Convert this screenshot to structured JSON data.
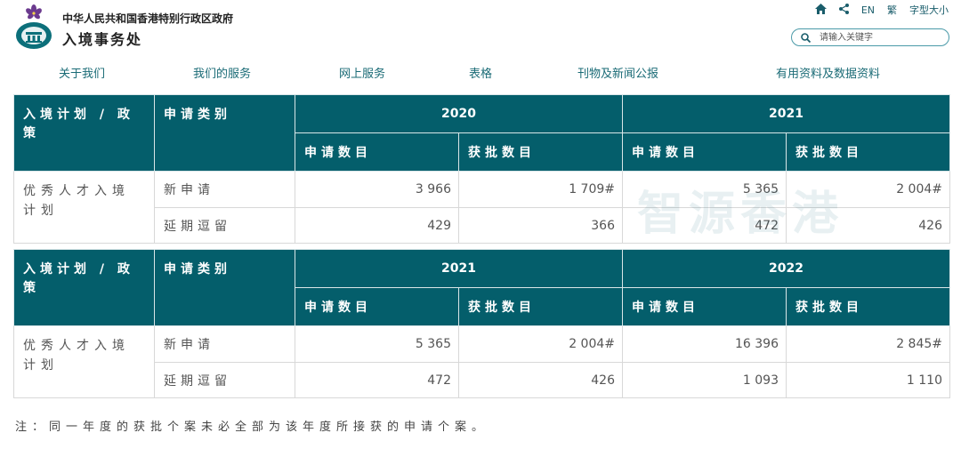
{
  "header": {
    "gov_name": "中华人民共和国香港特别行政区政府",
    "dept_name": "入境事务处",
    "tools": {
      "home_icon": "home-icon",
      "share_icon": "share-icon",
      "lang_en": "EN",
      "lang_tc": "繁",
      "font_size": "字型大小"
    },
    "search": {
      "placeholder": "请输入关键字",
      "icon": "search-icon"
    }
  },
  "nav": [
    {
      "label": "关于我们"
    },
    {
      "label": "我们的服务"
    },
    {
      "label": "网上服务"
    },
    {
      "label": "表格"
    },
    {
      "label": "刊物及新闻公报"
    },
    {
      "label": "有用资料及数据资料"
    }
  ],
  "watermark": "智源香港",
  "colors": {
    "header_bg": "#045e6b",
    "link": "#1a6b76"
  },
  "tables": [
    {
      "col_scheme": "入境计划 / 政策",
      "col_category": "申请类别",
      "years": [
        "2020",
        "2021"
      ],
      "sub_apply": "申请数目",
      "sub_approved": "获批数目",
      "scheme_name": "优秀人才入境计划",
      "rows": [
        {
          "category": "新申请",
          "values": [
            "3 966",
            "1 709#",
            "5 365",
            "2 004#"
          ]
        },
        {
          "category": "延期逗留",
          "values": [
            "429",
            "366",
            "472",
            "426"
          ]
        }
      ]
    },
    {
      "col_scheme": "入境计划 / 政策",
      "col_category": "申请类别",
      "years": [
        "2021",
        "2022"
      ],
      "sub_apply": "申请数目",
      "sub_approved": "获批数目",
      "scheme_name": "优秀人才入境计划",
      "rows": [
        {
          "category": "新申请",
          "values": [
            "5 365",
            "2 004#",
            "16 396",
            "2 845#"
          ]
        },
        {
          "category": "延期逗留",
          "values": [
            "472",
            "426",
            "1 093",
            "1 110"
          ]
        }
      ]
    }
  ],
  "note": "注：同一年度的获批个案未必全部为该年度所接获的申请个案。"
}
